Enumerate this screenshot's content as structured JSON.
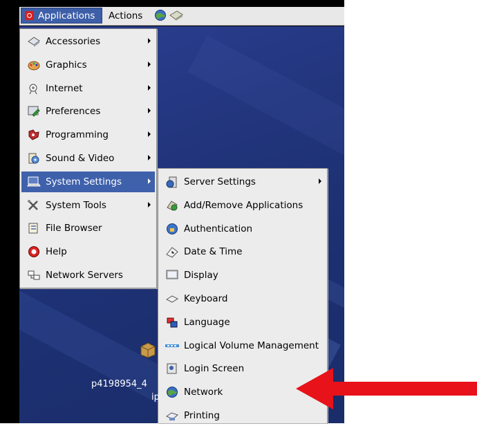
{
  "panel": {
    "applications_label": "Applications",
    "actions_label": "Actions"
  },
  "main_menu": {
    "items": [
      {
        "label": "Accessories",
        "icon": "accessories-icon",
        "submenu": true
      },
      {
        "label": "Graphics",
        "icon": "graphics-icon",
        "submenu": true
      },
      {
        "label": "Internet",
        "icon": "internet-icon",
        "submenu": true
      },
      {
        "label": "Preferences",
        "icon": "preferences-icon",
        "submenu": true
      },
      {
        "label": "Programming",
        "icon": "programming-icon",
        "submenu": true
      },
      {
        "label": "Sound & Video",
        "icon": "sound-video-icon",
        "submenu": true
      },
      {
        "label": "System Settings",
        "icon": "system-settings-icon",
        "submenu": true,
        "active": true
      },
      {
        "label": "System Tools",
        "icon": "system-tools-icon",
        "submenu": true
      },
      {
        "label": "File Browser",
        "icon": "file-browser-icon",
        "submenu": false
      },
      {
        "label": "Help",
        "icon": "help-icon",
        "submenu": false
      },
      {
        "label": "Network Servers",
        "icon": "network-servers-icon",
        "submenu": false
      }
    ]
  },
  "sub_menu": {
    "items": [
      {
        "label": "Server Settings",
        "icon": "server-settings-icon",
        "submenu": true
      },
      {
        "label": "Add/Remove Applications",
        "icon": "add-remove-icon",
        "submenu": false
      },
      {
        "label": "Authentication",
        "icon": "authentication-icon",
        "submenu": false
      },
      {
        "label": "Date & Time",
        "icon": "clock-icon",
        "submenu": false
      },
      {
        "label": "Display",
        "icon": "display-icon",
        "submenu": false
      },
      {
        "label": "Keyboard",
        "icon": "keyboard-icon",
        "submenu": false
      },
      {
        "label": "Language",
        "icon": "language-icon",
        "submenu": false
      },
      {
        "label": "Logical Volume Management",
        "icon": "lvm-icon",
        "submenu": false
      },
      {
        "label": "Login Screen",
        "icon": "login-screen-icon",
        "submenu": false
      },
      {
        "label": "Network",
        "icon": "network-icon",
        "submenu": false
      },
      {
        "label": "Printing",
        "icon": "printer-icon",
        "submenu": false
      }
    ]
  },
  "desktop": {
    "file_caption_line1": "p4198954_4",
    "file_caption_line2": "ip"
  },
  "colors": {
    "accent": "#3f61ab",
    "desktop": "#23367f",
    "arrow": "#e8121a"
  }
}
